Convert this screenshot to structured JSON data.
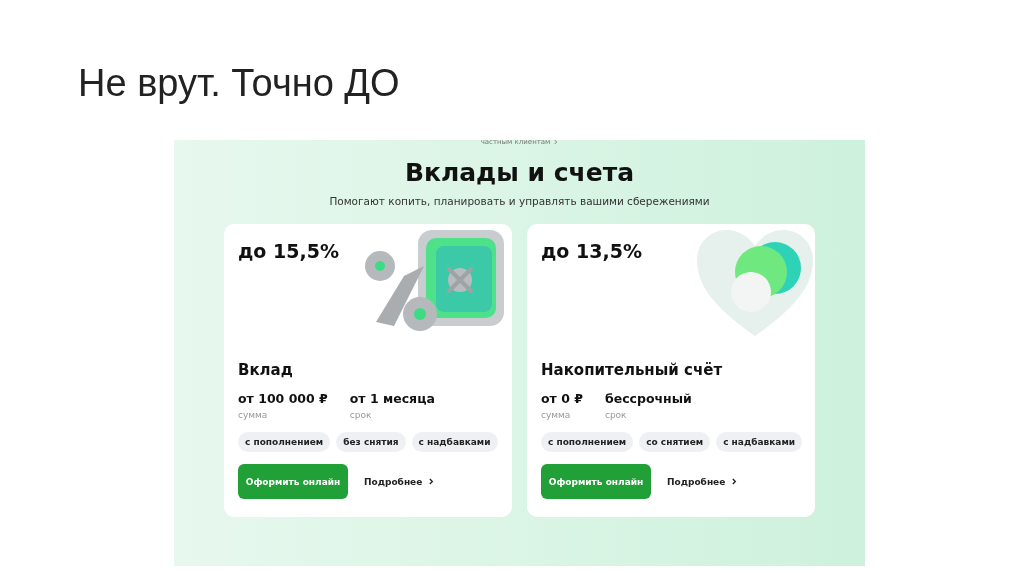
{
  "slide": {
    "title": "Не врут. Точно ДО"
  },
  "page": {
    "breadcrumb": "частным клиентам",
    "heading": "Вклады и счета",
    "subtitle": "Помогают копить, планировать и управлять вашими сбережениями",
    "cards": [
      {
        "kind": "deposit",
        "rate": "до 15,5%",
        "name": "Вклад",
        "amount": "от 100 000 ₽",
        "amount_label": "сумма",
        "term": "от 1 месяца",
        "term_label": "срок",
        "tags": [
          "с пополнением",
          "без снятия",
          "с надбавками"
        ],
        "apply_button": "Оформить онлайн",
        "more_link": "Подробнее"
      },
      {
        "kind": "savings",
        "rate": "до 13,5%",
        "name": "Накопительный счёт",
        "amount": "от 0 ₽",
        "amount_label": "сумма",
        "term": "бессрочный",
        "term_label": "срок",
        "tags": [
          "с пополнением",
          "со снятием",
          "с надбавками"
        ],
        "apply_button": "Оформить онлайн",
        "more_link": "Подробнее"
      }
    ]
  }
}
